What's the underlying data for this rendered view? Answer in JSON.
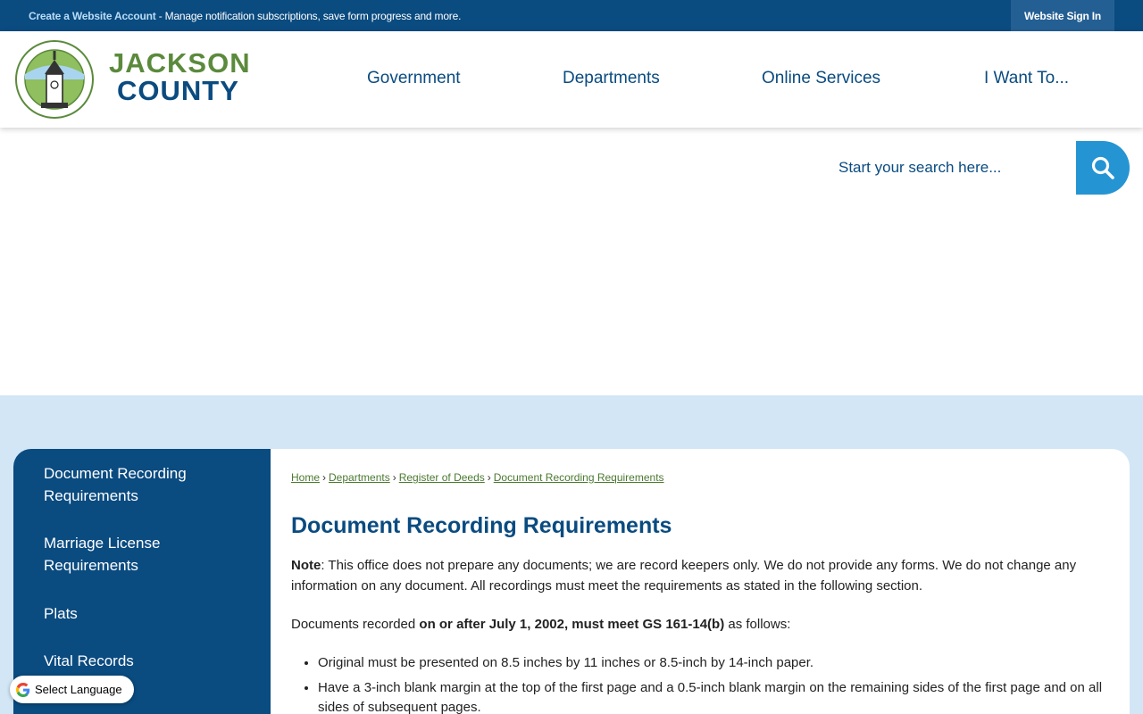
{
  "topbar": {
    "create_link": "Create a Website Account",
    "message": " - Manage notification subscriptions, save form progress and more.",
    "signin": "Website Sign In"
  },
  "logo": {
    "line1": "JACKSON",
    "line2": "COUNTY",
    "seal_text_top": "JACKSON COUNTY",
    "seal_text_bottom": "NORTH CAROLINA"
  },
  "nav": [
    "Government",
    "Departments",
    "Online Services",
    "I Want To..."
  ],
  "search": {
    "placeholder": "Start your search here..."
  },
  "sidebar": {
    "items": [
      {
        "label": "Document Recording Requirements"
      },
      {
        "label": "Marriage License Requirements"
      },
      {
        "label": "Plats"
      },
      {
        "label": "Vital Records"
      }
    ]
  },
  "breadcrumb": [
    "Home",
    "Departments",
    "Register of Deeds",
    "Document Recording Requirements"
  ],
  "page": {
    "title": "Document Recording Requirements",
    "note_label": "Note",
    "note_text": ": This office does not prepare any documents; we are record keepers only. We do not provide any forms. We do not change any information on any document. All recordings must meet the requirements as stated in the following section.",
    "docs_prefix": "Documents recorded ",
    "docs_bold": "on or after July 1, 2002, must meet GS 161-14(b)",
    "docs_suffix": " as follows:",
    "bullets": [
      "Original must be presented on 8.5 inches by 11 inches or 8.5-inch by 14-inch paper.",
      "Have a 3-inch blank margin at the top of the first page and a 0.5-inch blank margin on the remaining sides of the first page and on all sides of subsequent pages."
    ]
  },
  "translate": {
    "label": "Select Language"
  },
  "colors": {
    "navy": "#0a4b80",
    "green": "#5b8a3c",
    "search_blue": "#2594d3",
    "band": "#d2e6f6"
  }
}
